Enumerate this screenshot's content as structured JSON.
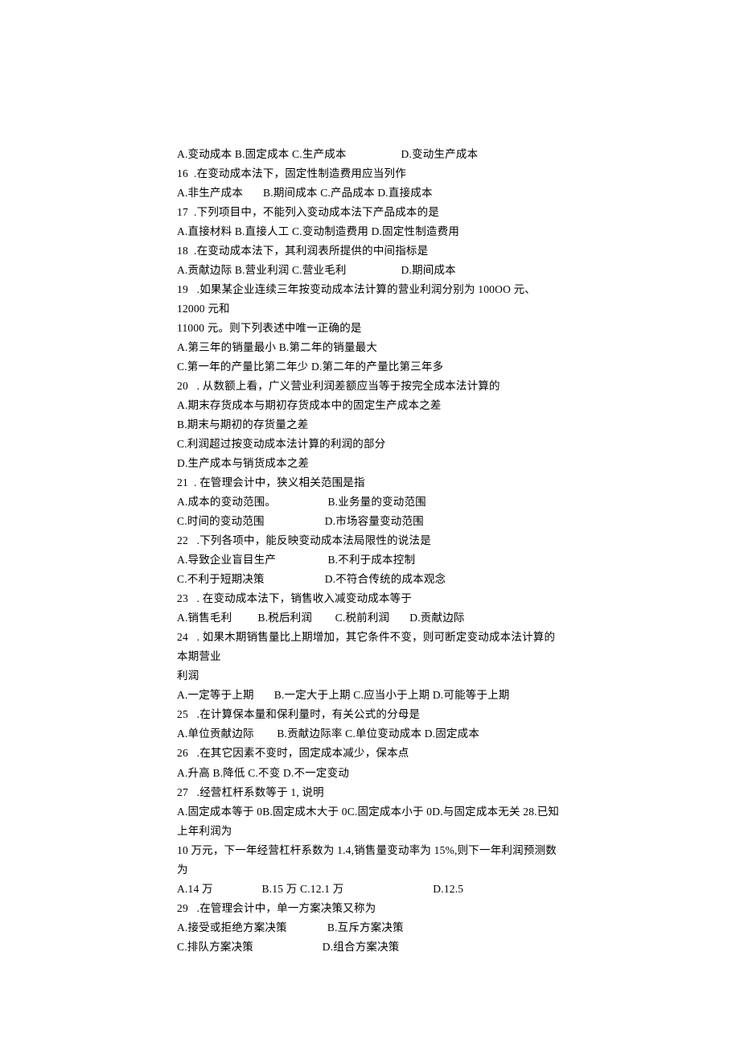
{
  "lines": [
    "A.变动成本 B.固定成本 C.生产成本                   D.变动生产成本",
    "16  .在变动成本法下，固定性制造费用应当列作",
    "A.非生产成本       B.期间成本 C.产品成本 D.直接成本",
    "17  .下列项目中，不能列入变动成本法下产品成本的是",
    "A.直接材料 B.直接人工 C.变动制造费用 D.固定性制造费用",
    "18  .在变动成本法下，其利润表所提供的中间指标是",
    "A.贡献边际 B.营业利润 C.营业毛利                   D.期间成本",
    "19   .如果某企业连续三年按变动成本法计算的营业利润分别为 100OO 元、12000 元和",
    "11000 元。则下列表述中唯一正确的是",
    "A.第三年的销量最小 B.第二年的销量最大",
    "C.第一年的产量比第二年少 D.第二年的产量比第三年多",
    "20   . 从数额上看，广义营业利润差额应当等于按完全成本法计算的",
    "A.期末存货成本与期初存货成本中的固定生产成本之差",
    "B.期末与期初的存货量之差",
    "C.利润超过按变动成本法计算的利润的部分",
    "D.生产成本与销货成本之差",
    "21  . 在管理会计中，狭义相关范围是指",
    "A.成本的变动范围。                  B.业务量的变动范围",
    "C.时间的变动范围                     D.市场容量变动范围",
    "22   .下列各项中，能反映变动成本法局限性的说法是",
    "A.导致企业盲目生产                  B.不利于成本控制",
    "C.不利于短期决策                     D.不符合传统的成本观念",
    "23   . 在变动成本法下，销售收入减变动成本等于",
    "A.销售毛利         B.税后利润        C.税前利润       D.贡献边际",
    "24   . 如果木期销售量比上期增加，其它条件不变，则可断定变动成本法计算的本期营业",
    "利润",
    "A.一定等于上期       B.一定大于上期 C.应当小于上期 D.可能等于上期",
    "25   .在计算保本量和保利量时，有关公式的分母是",
    "A.单位贡献边际        B.贡献边际率 C.单位变动成本 D.固定成本",
    "26   .在其它因素不变时，固定成本减少，保本点",
    "A.升高 B.降低 C.不变 D.不一定变动",
    "27   .经营杠杆系数等于 1, 说明",
    "A.固定成本等于 0B.固定成木大于 0C.固定成本小于 0D.与固定成本无关 28.已知上年利润为",
    "10 万元，下一年经营杠杆系数为 1.4,销售量变动率为 15%,则下一年利润预测数为",
    "A.14 万                 B.15 万 C.12.1 万                               D.12.5",
    "29   .在管理会计中，单一方案决策又称为",
    "A.接受或拒绝方案决策              B.互斥方案决策",
    "C.排队方案决策                        D.组合方案决策"
  ]
}
